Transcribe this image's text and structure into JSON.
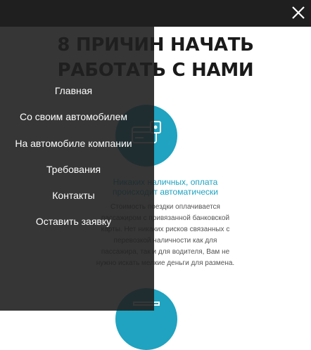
{
  "headline": {
    "line1": "8 ПРИЧИН НАЧАТЬ",
    "line2": "РАБОТАТЬ С НАМИ"
  },
  "feature": {
    "title_line1": "Никаких наличных, оплата",
    "title_line2": "происходит автоматически",
    "text_lines": [
      "Стоимость поездки оплачивается",
      "пассажиром с привязанной банковской",
      "карты. Нет никаких рисков связанных с",
      "перевозкой наличности как для",
      "пассажира, так и для водителя, Вам не",
      "нужно искать мелкие деньги для размена."
    ],
    "icon": "payment-card-icon"
  },
  "menu": {
    "items": [
      {
        "label": "Главная"
      },
      {
        "label": "Со своим автомобилем"
      },
      {
        "label": "На автомобиле компании"
      },
      {
        "label": "Требования"
      },
      {
        "label": "Контакты"
      },
      {
        "label": "Оставить заявку"
      }
    ],
    "close_icon": "close-icon"
  },
  "colors": {
    "accent": "#1fa3c0",
    "topbar": "#1f1f1f",
    "overlay": "#202020"
  }
}
